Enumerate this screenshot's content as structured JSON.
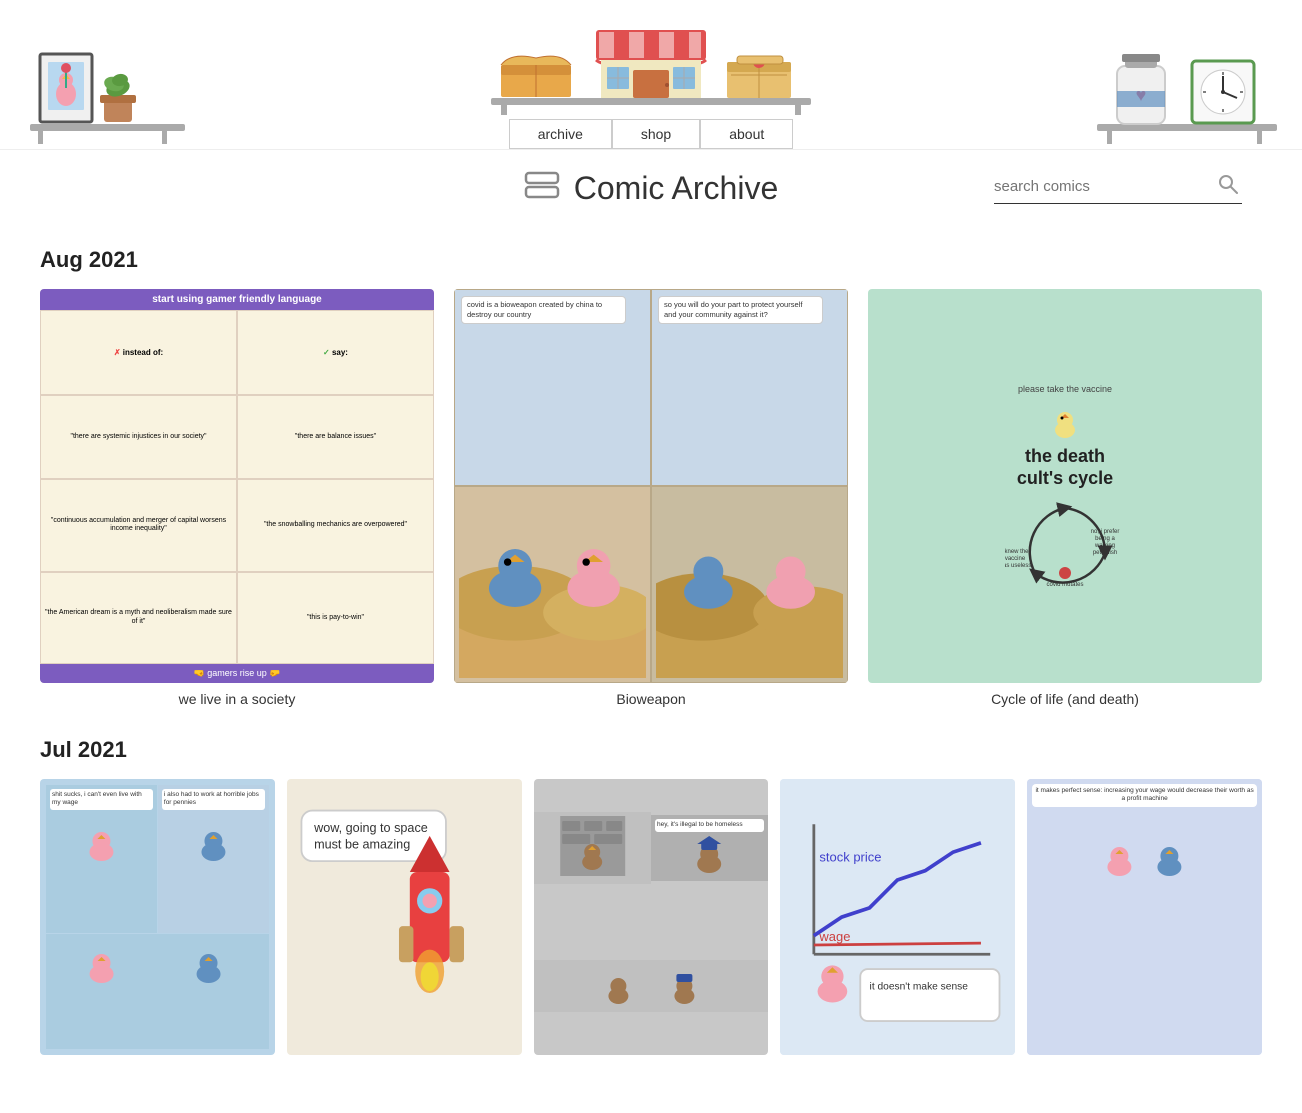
{
  "header": {
    "nav_items": [
      {
        "label": "archive",
        "href": "#"
      },
      {
        "label": "shop",
        "href": "#"
      },
      {
        "label": "about",
        "href": "#"
      }
    ]
  },
  "page": {
    "title": "Comic Archive",
    "title_icon": "▭",
    "search_placeholder": "search comics"
  },
  "sections": [
    {
      "month": "Aug 2021",
      "comics": [
        {
          "title": "we live in a society",
          "type": "society"
        },
        {
          "title": "Bioweapon",
          "type": "bioweapon"
        },
        {
          "title": "Cycle of life (and death)",
          "type": "cycle"
        }
      ]
    },
    {
      "month": "Jul 2021",
      "comics": [
        {
          "title": "",
          "type": "jul-wage"
        },
        {
          "title": "",
          "type": "jul-space"
        },
        {
          "title": "",
          "type": "jul-homeless"
        },
        {
          "title": "",
          "type": "jul-stocks"
        },
        {
          "title": "",
          "type": "jul-worth"
        }
      ]
    }
  ],
  "society_comic": {
    "header": "start using gamer friendly language",
    "col1_header": "✗ instead of:",
    "col2_header": "✓ say:",
    "rows": [
      [
        "\"there are systemic injustices in our society\"",
        "\"there are balance issues\""
      ],
      [
        "\"continuous accumulation and merger of capital worsens income inequality\"",
        "\"the snowballing mechanics are overpowered\""
      ],
      [
        "\"the American dream is a myth and neoliberalism made sure of it\"",
        "\"this is pay-to-win\""
      ]
    ],
    "footer": "🤜 gamers rise up 🤛"
  },
  "bioweapon_comic": {
    "panels": [
      {
        "text": "covid is a bioweapon created by china to destroy our country",
        "style": "speech"
      },
      {
        "text": "so you will do your part to protect yourself and your community against it?",
        "style": "speech"
      },
      {
        "text": "",
        "style": "birds"
      },
      {
        "text": "",
        "style": "birds2"
      }
    ]
  },
  "cycle_comic": {
    "top_label": "please take the vaccine",
    "center_title": "the death cult's cycle",
    "nodes": [
      "i knew the vaccine was useless",
      "no, i prefer being a walking petri dish",
      "covid mutates"
    ]
  }
}
